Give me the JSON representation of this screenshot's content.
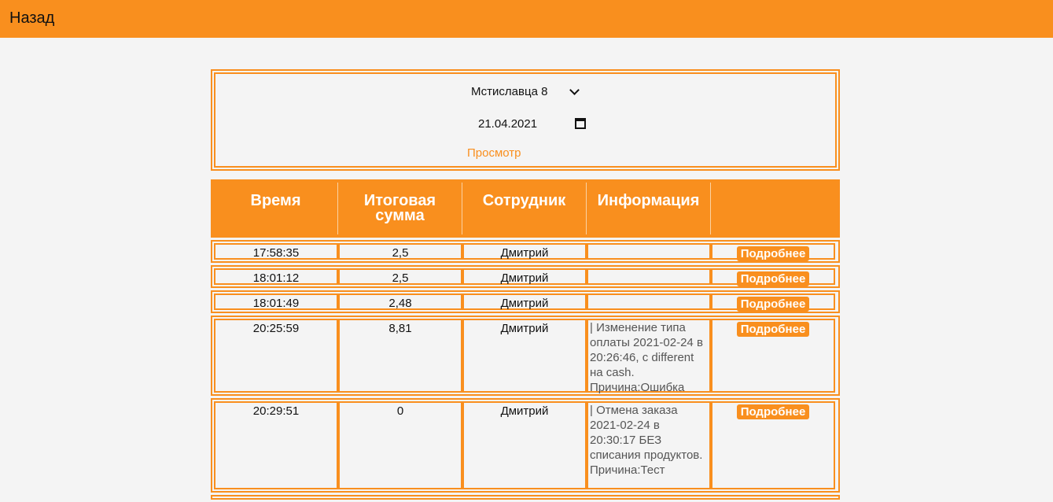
{
  "nav": {
    "back_label": "Назад"
  },
  "filter": {
    "location": "Мстиславца 8",
    "date": "21.04.2021",
    "view_label": "Просмотр"
  },
  "table": {
    "headers": [
      "Время",
      "Итоговая сумма",
      "Сотрудник",
      "Информация",
      ""
    ],
    "details_label": "Подробнее",
    "rows": [
      {
        "time": "17:58:35",
        "total": "2,5",
        "employee": "Дмитрий",
        "info": ""
      },
      {
        "time": "18:01:12",
        "total": "2,5",
        "employee": "Дмитрий",
        "info": ""
      },
      {
        "time": "18:01:49",
        "total": "2,48",
        "employee": "Дмитрий",
        "info": ""
      },
      {
        "time": "20:25:59",
        "total": "8,81",
        "employee": "Дмитрий",
        "info": "| Изменение типа оплаты 2021-02-24 в 20:26:46, с different на cash. Причина:Ошибка"
      },
      {
        "time": "20:29:51",
        "total": "0",
        "employee": "Дмитрий",
        "info": "| Отмена заказа 2021-02-24 в 20:30:17 БЕЗ списания продуктов. Причина:Тест"
      }
    ]
  },
  "colors": {
    "accent": "#f98f1e",
    "background": "#f4f4f4"
  }
}
